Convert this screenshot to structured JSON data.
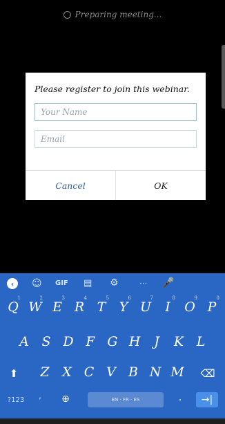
{
  "status": {
    "text": "Preparing meeting..."
  },
  "dialog": {
    "title": "Please register to join this webinar.",
    "name_placeholder": "Your Name",
    "email_placeholder": "Email",
    "cancel_label": "Cancel",
    "ok_label": "OK"
  },
  "keyboard": {
    "toolbar": {
      "gif_label": "GIF",
      "more_label": "···"
    },
    "row1": [
      {
        "k": "Q",
        "n": "1"
      },
      {
        "k": "W",
        "n": "2"
      },
      {
        "k": "E",
        "n": "3"
      },
      {
        "k": "R",
        "n": "4"
      },
      {
        "k": "T",
        "n": "5"
      },
      {
        "k": "Y",
        "n": "6"
      },
      {
        "k": "U",
        "n": "7"
      },
      {
        "k": "I",
        "n": "8"
      },
      {
        "k": "O",
        "n": "9"
      },
      {
        "k": "P",
        "n": "0"
      }
    ],
    "row2": [
      "A",
      "S",
      "D",
      "F",
      "G",
      "H",
      "J",
      "K",
      "L"
    ],
    "row3": [
      "Z",
      "X",
      "C",
      "V",
      "B",
      "N",
      "M"
    ],
    "symbols_label": "?123",
    "comma_label": ",",
    "space_label": "EN · FR · ES",
    "period_label": ".",
    "enter_label": "→|",
    "accent_color": "#2a66c3"
  }
}
